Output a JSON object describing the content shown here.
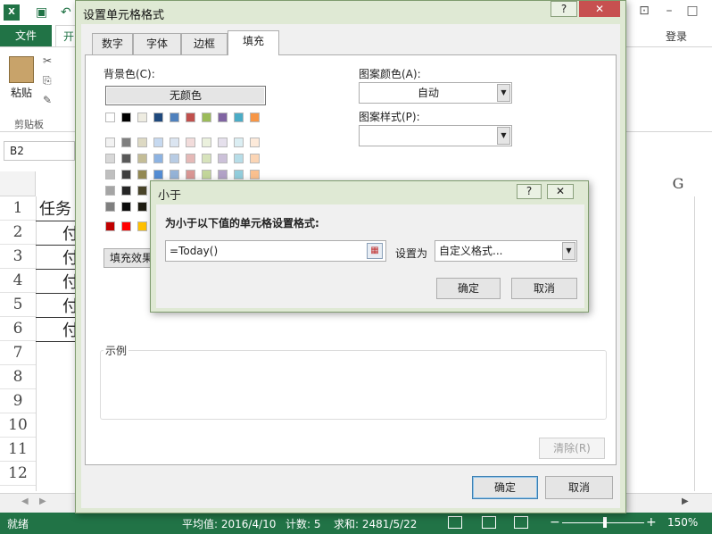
{
  "excel": {
    "logo": "X",
    "qat_icons": [
      "save-icon",
      "undo-icon"
    ],
    "tabs": {
      "file": "文件",
      "home": "开"
    },
    "login": "登录",
    "ribbon": {
      "paste": "粘贴",
      "clipboard": "剪贴板"
    },
    "name_box": "B2",
    "column_g": "G",
    "rows": [
      "1",
      "2",
      "3",
      "4",
      "5",
      "6",
      "7",
      "8",
      "9",
      "10",
      "11",
      "12"
    ],
    "cells": {
      "r1": "任务",
      "r2": "付",
      "r3": "付",
      "r4": "付",
      "r5": "付",
      "r6": "付"
    },
    "status": {
      "ready": "就绪",
      "average": "平均值: 2016/4/10",
      "count": "计数: 5",
      "sum": "求和: 2481/5/22",
      "zoom": "150%"
    }
  },
  "format_dialog": {
    "title": "设置单元格格式",
    "help": "?",
    "close": "✕",
    "tabs": [
      "数字",
      "字体",
      "边框",
      "填充"
    ],
    "active_tab": "填充",
    "background_color_label": "背景色(C):",
    "no_color_button": "无颜色",
    "fill_effects_button": "填充效果",
    "pattern_color_label": "图案颜色(A):",
    "pattern_color_value": "自动",
    "pattern_style_label": "图案样式(P):",
    "sample_label": "示例",
    "clear_button": "清除(R)",
    "ok": "确定",
    "cancel": "取消",
    "palette": {
      "theme_row": [
        "#ffffff",
        "#000000",
        "#eeece1",
        "#1f497d",
        "#4f81bd",
        "#c0504d",
        "#9bbb59",
        "#8064a2",
        "#4bacc6",
        "#f79646"
      ],
      "tint_rows": [
        [
          "#f2f2f2",
          "#7f7f7f",
          "#ddd9c3",
          "#c6d9f0",
          "#dbe5f1",
          "#f2dcdb",
          "#ebf1dd",
          "#e5e0ec",
          "#dbeef3",
          "#fdeada"
        ],
        [
          "#d8d8d8",
          "#595959",
          "#c4bd97",
          "#8db3e2",
          "#b8cce4",
          "#e5b9b7",
          "#d7e3bc",
          "#ccc1d9",
          "#b7dde8",
          "#fbd5b5"
        ],
        [
          "#bfbfbf",
          "#3f3f3f",
          "#938953",
          "#548dd4",
          "#95b3d7",
          "#d99694",
          "#c3d69b",
          "#b2a2c7",
          "#92cddc",
          "#fac08f"
        ],
        [
          "#a5a5a5",
          "#262626",
          "#494429",
          "#17365d",
          "#366092",
          "#953734",
          "#76923c",
          "#5f497a",
          "#31859b",
          "#e36c09"
        ],
        [
          "#7f7f7f",
          "#0c0c0c",
          "#1d1b10",
          "#0f243e",
          "#244061",
          "#632423",
          "#4f6128",
          "#3f3151",
          "#205867",
          "#974806"
        ]
      ],
      "standard_row": [
        "#c00000",
        "#ff0000",
        "#ffc000"
      ]
    }
  },
  "less_than_dialog": {
    "title": "小于",
    "help": "?",
    "close": "✕",
    "instruction": "为小于以下值的单元格设置格式:",
    "formula_value": "=Today()",
    "set_as_label": "设置为",
    "format_value": "自定义格式...",
    "ok": "确定",
    "cancel": "取消"
  }
}
